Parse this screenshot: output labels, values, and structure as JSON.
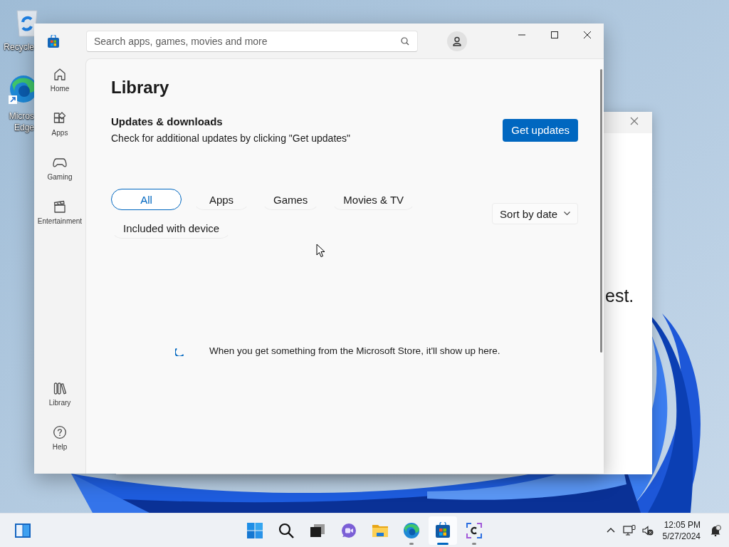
{
  "desktop_icons": [
    {
      "label_lines": [
        "Recycle"
      ]
    },
    {
      "label_lines": [
        "Micros",
        "Edge"
      ]
    }
  ],
  "background_window": {
    "text": "est."
  },
  "store_window": {
    "search": {
      "placeholder": "Search apps, games, movies and more"
    },
    "nav_top": [
      {
        "label": "Home"
      },
      {
        "label": "Apps"
      },
      {
        "label": "Gaming"
      },
      {
        "label": "Entertainment"
      }
    ],
    "nav_bottom": [
      {
        "label": "Library"
      },
      {
        "label": "Help"
      }
    ],
    "title": "Library",
    "updates": {
      "heading": "Updates & downloads",
      "description": "Check for additional updates by clicking \"Get updates\"",
      "button": "Get updates"
    },
    "filters": [
      {
        "label": "All",
        "selected": true
      },
      {
        "label": "Apps",
        "selected": false
      },
      {
        "label": "Games",
        "selected": false
      },
      {
        "label": "Movies & TV",
        "selected": false
      },
      {
        "label": "Included with device",
        "selected": false
      }
    ],
    "sort": {
      "label": "Sort by date"
    },
    "empty_message": "When you get something from the Microsoft Store, it'll show up here."
  },
  "taskbar": {
    "apps": [
      {
        "running": false,
        "selected": false
      },
      {
        "running": false,
        "selected": false
      },
      {
        "running": false,
        "selected": false
      },
      {
        "running": false,
        "selected": false
      },
      {
        "running": false,
        "selected": false
      },
      {
        "running": true,
        "selected": false
      },
      {
        "running": true,
        "selected": true
      },
      {
        "running": true,
        "selected": false
      }
    ],
    "clock": {
      "time": "12:05 PM",
      "date": "5/27/2024"
    }
  }
}
